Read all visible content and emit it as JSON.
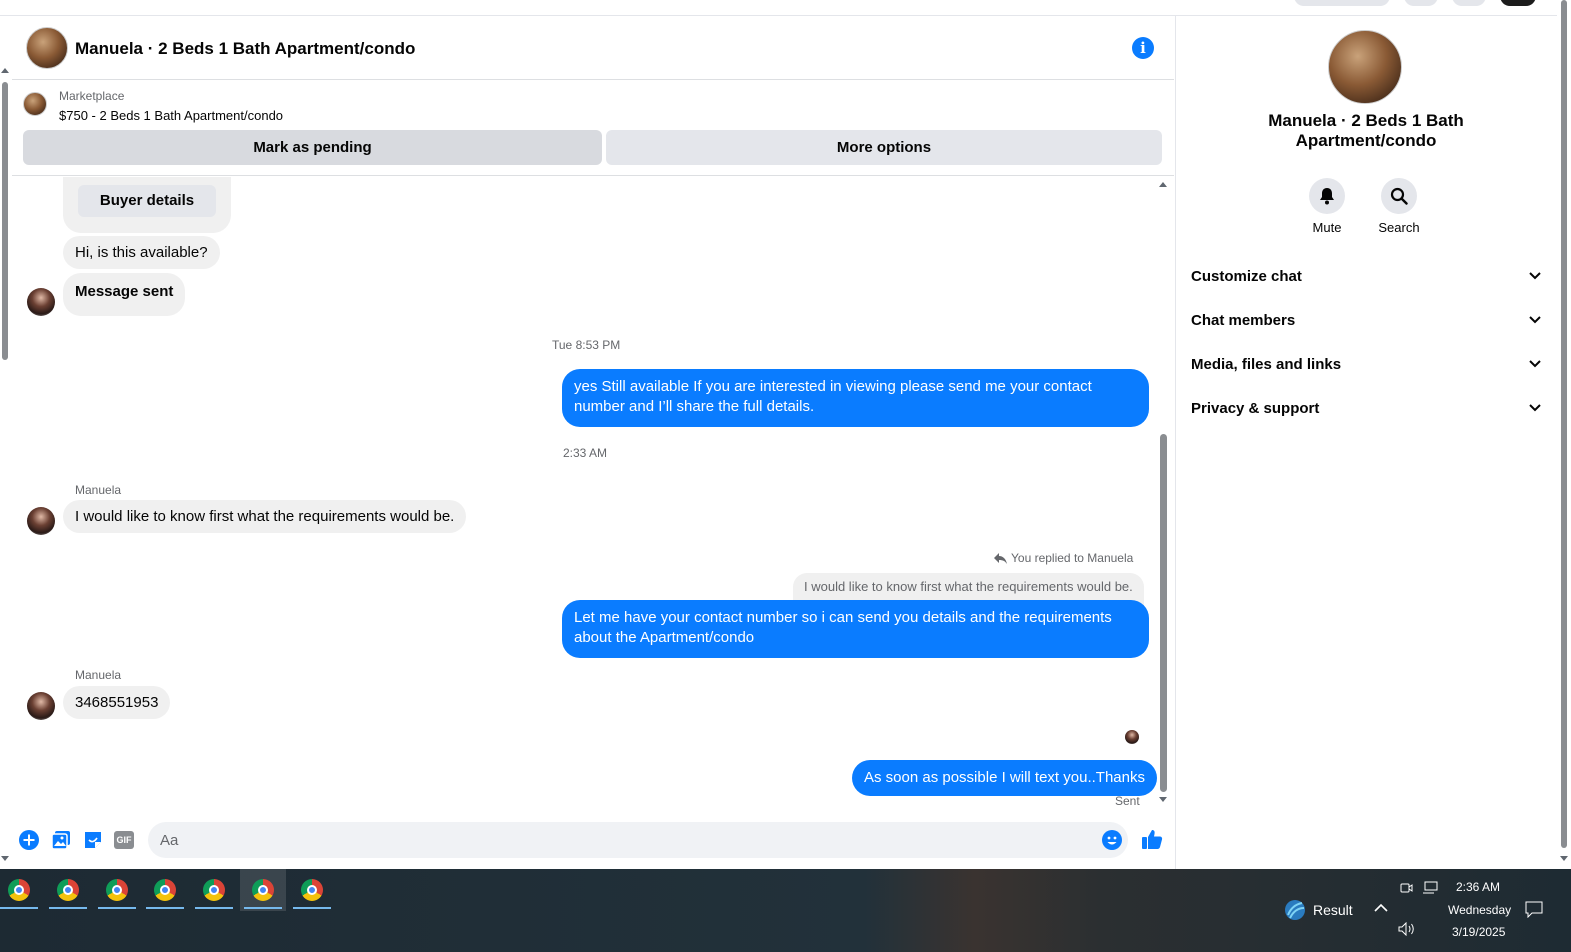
{
  "header": {
    "title": "Manuela · 2 Beds 1 Bath Apartment/condo",
    "info_glyph": "i"
  },
  "marketplace": {
    "label": "Marketplace",
    "listing": "$750 - 2 Beds 1 Bath Apartment/condo",
    "mark_pending": "Mark as pending",
    "more_options": "More options"
  },
  "messages": {
    "buyer_details": "Buyer details",
    "m1": "Hi, is this available?",
    "m2": "Message sent",
    "ts1": "Tue 8:53 PM",
    "out1": "yes Still available If you are interested in viewing please send me your contact number and I’ll share the full details.",
    "ts2": "2:33 AM",
    "sender1": "Manuela",
    "in1": "I would like to know first what the requirements would be.",
    "reply_note": "You replied to Manuela",
    "quoted": "I would like to know first what the requirements would be.",
    "out2": "Let me have your contact number so i can send you details and the requirements about the Apartment/condo",
    "sender2": "Manuela",
    "in2": "3468551953",
    "out3": "As soon as possible I will text you..Thanks",
    "status": "Sent"
  },
  "composer": {
    "placeholder": "Aa",
    "gif_label": "GIF"
  },
  "panel": {
    "title": "Manuela · 2 Beds 1 Bath Apartment/condo",
    "mute": "Mute",
    "search": "Search",
    "sections": [
      "Customize chat",
      "Chat members",
      "Media, files and links",
      "Privacy & support"
    ]
  },
  "taskbar": {
    "app_count": 7,
    "result": "Result",
    "time": "2:36 AM",
    "day": "Wednesday",
    "date": "3/19/2025"
  },
  "colors": {
    "accent": "#0a7cff",
    "incoming": "#f0f0f0",
    "muted_text": "#65676b"
  }
}
